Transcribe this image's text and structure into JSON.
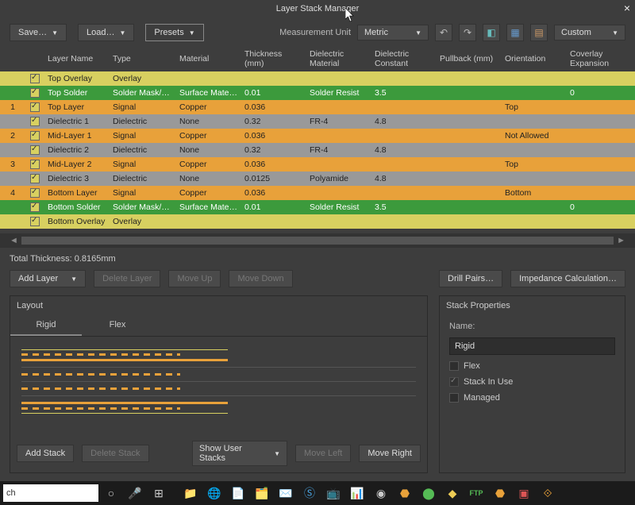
{
  "window": {
    "title": "Layer Stack Manager"
  },
  "toolbar": {
    "save": "Save…",
    "load": "Load…",
    "presets": "Presets",
    "measurement_label": "Measurement Unit",
    "measurement_value": "Metric",
    "custom": "Custom"
  },
  "grid": {
    "headers": {
      "layer_name": "Layer Name",
      "type": "Type",
      "material": "Material",
      "thickness": "Thickness (mm)",
      "die_mat": "Dielectric Material",
      "die_const": "Dielectric Constant",
      "pullback": "Pullback (mm)",
      "orientation": "Orientation",
      "coverlay": "Coverlay Expansion"
    },
    "rows": [
      {
        "idx": "",
        "name": "Top Overlay",
        "type": "Overlay",
        "material": "",
        "thk": "",
        "dmat": "",
        "dconst": "",
        "pull": "",
        "orient": "",
        "cov": "",
        "color": "overlay"
      },
      {
        "idx": "",
        "name": "Top Solder",
        "type": "Solder Mask/Co...",
        "material": "Surface Material",
        "thk": "0.01",
        "dmat": "Solder Resist",
        "dconst": "3.5",
        "pull": "",
        "orient": "",
        "cov": "0",
        "color": "green"
      },
      {
        "idx": "1",
        "name": "Top Layer",
        "type": "Signal",
        "material": "Copper",
        "thk": "0.036",
        "dmat": "",
        "dconst": "",
        "pull": "",
        "orient": "Top",
        "cov": "",
        "color": "orange"
      },
      {
        "idx": "",
        "name": "Dielectric 1",
        "type": "Dielectric",
        "material": "None",
        "thk": "0.32",
        "dmat": "FR-4",
        "dconst": "4.8",
        "pull": "",
        "orient": "",
        "cov": "",
        "color": "gray"
      },
      {
        "idx": "2",
        "name": "Mid-Layer 1",
        "type": "Signal",
        "material": "Copper",
        "thk": "0.036",
        "dmat": "",
        "dconst": "",
        "pull": "",
        "orient": "Not Allowed",
        "cov": "",
        "color": "orange"
      },
      {
        "idx": "",
        "name": "Dielectric 2",
        "type": "Dielectric",
        "material": "None",
        "thk": "0.32",
        "dmat": "FR-4",
        "dconst": "4.8",
        "pull": "",
        "orient": "",
        "cov": "",
        "color": "gray"
      },
      {
        "idx": "3",
        "name": "Mid-Layer 2",
        "type": "Signal",
        "material": "Copper",
        "thk": "0.036",
        "dmat": "",
        "dconst": "",
        "pull": "",
        "orient": "Top",
        "cov": "",
        "color": "orange"
      },
      {
        "idx": "",
        "name": "Dielectric 3",
        "type": "Dielectric",
        "material": "None",
        "thk": "0.0125",
        "dmat": "Polyamide",
        "dconst": "4.8",
        "pull": "",
        "orient": "",
        "cov": "",
        "color": "gray"
      },
      {
        "idx": "4",
        "name": "Bottom Layer",
        "type": "Signal",
        "material": "Copper",
        "thk": "0.036",
        "dmat": "",
        "dconst": "",
        "pull": "",
        "orient": "Bottom",
        "cov": "",
        "color": "orange"
      },
      {
        "idx": "",
        "name": "Bottom Solder",
        "type": "Solder Mask/Co...",
        "material": "Surface Material",
        "thk": "0.01",
        "dmat": "Solder Resist",
        "dconst": "3.5",
        "pull": "",
        "orient": "",
        "cov": "0",
        "color": "green"
      },
      {
        "idx": "",
        "name": "Bottom Overlay",
        "type": "Overlay",
        "material": "",
        "thk": "",
        "dmat": "",
        "dconst": "",
        "pull": "",
        "orient": "",
        "cov": "",
        "color": "overlay"
      }
    ]
  },
  "summary": {
    "total_thickness": "Total Thickness: 0.8165mm"
  },
  "buttons": {
    "add_layer": "Add Layer",
    "delete_layer": "Delete Layer",
    "move_up": "Move Up",
    "move_down": "Move Down",
    "drill_pairs": "Drill Pairs…",
    "impedance": "Impedance Calculation…",
    "add_stack": "Add Stack",
    "delete_stack": "Delete Stack",
    "show_user_stacks": "Show User Stacks",
    "move_left": "Move Left",
    "move_right": "Move Right"
  },
  "layout_panel": {
    "title": "Layout",
    "tab_rigid": "Rigid",
    "tab_flex": "Flex"
  },
  "props": {
    "title": "Stack Properties",
    "name_label": "Name:",
    "name_value": "Rigid",
    "flex_label": "Flex",
    "inuse_label": "Stack In Use",
    "managed_label": "Managed"
  },
  "taskbar": {
    "search": "ch"
  }
}
